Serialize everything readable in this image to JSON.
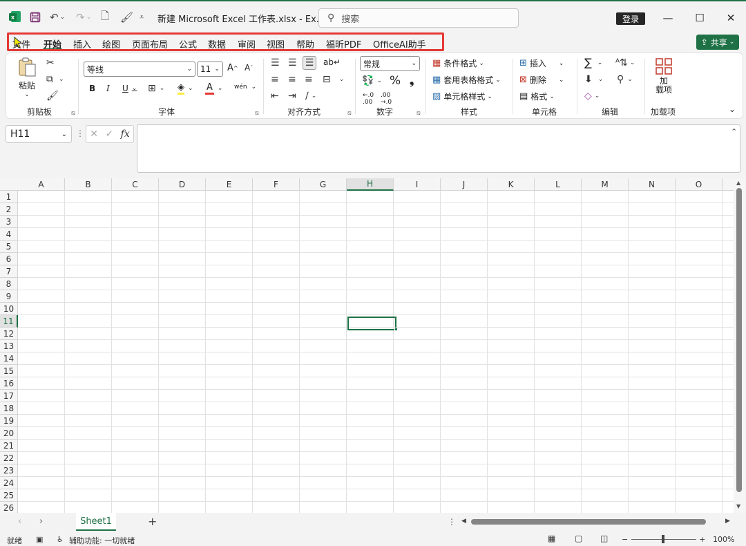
{
  "window": {
    "filename": "新建 Microsoft Excel 工作表.xlsx  -  Ex...",
    "search_placeholder": "搜索",
    "login_label": "登录",
    "minimize": "—",
    "maximize": "☐",
    "close": "✕"
  },
  "tabs": [
    "文件",
    "开始",
    "插入",
    "绘图",
    "页面布局",
    "公式",
    "数据",
    "审阅",
    "视图",
    "帮助",
    "福昕PDF",
    "OfficeAI助手"
  ],
  "share_label": "共享",
  "ribbon": {
    "clipboard": {
      "paste": "粘贴",
      "group": "剪贴板"
    },
    "font": {
      "name": "等线",
      "size": "11",
      "bold": "B",
      "italic": "I",
      "underline": "U",
      "grow": "A^",
      "shrink": "A˅",
      "group": "字体"
    },
    "alignment": {
      "group": "对齐方式"
    },
    "number": {
      "format": "常规",
      "percent": "%",
      "comma": "❟",
      "group": "数字"
    },
    "styles": {
      "conditional": "条件格式",
      "table": "套用表格格式",
      "cell_styles": "单元格样式",
      "group": "样式"
    },
    "cells": {
      "insert": "插入",
      "delete": "删除",
      "format": "格式",
      "group": "单元格"
    },
    "editing": {
      "sum": "∑",
      "group": "编辑"
    },
    "addins": {
      "label": "加\n载项",
      "label_line1": "加",
      "label_line2": "载项",
      "group": "加载项"
    }
  },
  "formula_bar": {
    "name_box": "H11",
    "fx": "fx"
  },
  "grid": {
    "columns": [
      "A",
      "B",
      "C",
      "D",
      "E",
      "F",
      "G",
      "H",
      "I",
      "J",
      "K",
      "L",
      "M",
      "N",
      "O"
    ],
    "rows": [
      "1",
      "2",
      "3",
      "4",
      "5",
      "6",
      "7",
      "8",
      "9",
      "10",
      "11",
      "12",
      "13",
      "14",
      "15",
      "16",
      "17",
      "18",
      "19",
      "20",
      "21",
      "22",
      "23",
      "24",
      "25",
      "26"
    ],
    "selected_column": "H",
    "selected_row": "11"
  },
  "sheets": [
    "Sheet1"
  ],
  "status": {
    "ready": "就绪",
    "accessibility": "辅助功能: 一切就绪",
    "zoom": "100%",
    "zoom_minus": "−",
    "zoom_plus": "+"
  },
  "colors": {
    "accent": "#1e7145",
    "highlight_box": "#e53935"
  }
}
